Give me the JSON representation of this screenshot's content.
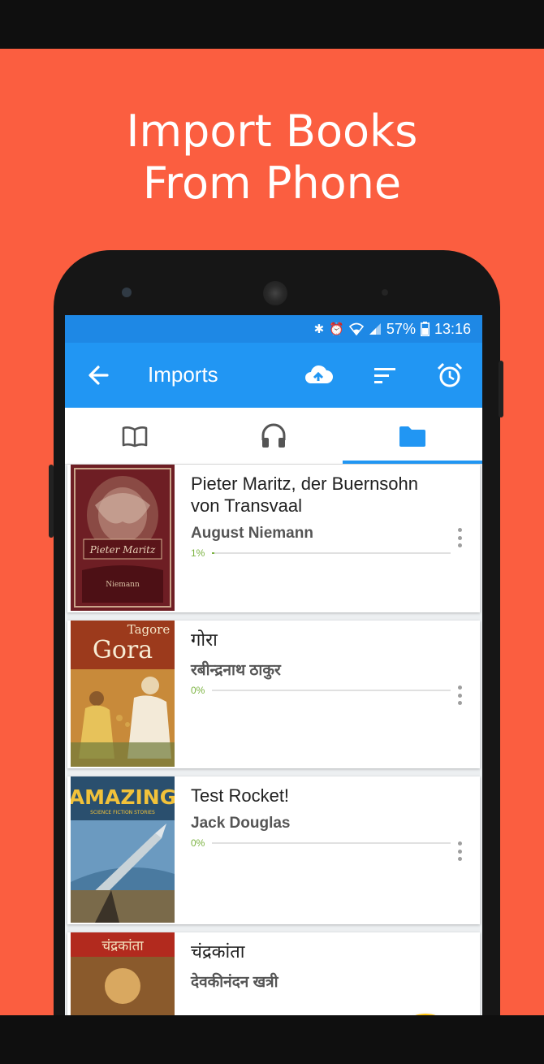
{
  "promo": {
    "line1": "Import Books",
    "line2": "From Phone"
  },
  "status_bar": {
    "battery": "57%",
    "time": "13:16",
    "icons": [
      "bluetooth-icon",
      "alarm-icon",
      "wifi-icon",
      "signal-icon",
      "battery-icon"
    ]
  },
  "toolbar": {
    "title": "Imports",
    "back_icon": "arrow-left-icon",
    "actions": [
      "cloud-upload-icon",
      "sort-icon",
      "alarm-clock-icon"
    ]
  },
  "tabs": [
    {
      "icon": "book-icon",
      "selected": false
    },
    {
      "icon": "headphones-icon",
      "selected": false
    },
    {
      "icon": "folder-icon",
      "selected": true
    }
  ],
  "books": [
    {
      "title": "Pieter Maritz, der Buernsohn von Transvaal",
      "author": "August Niemann",
      "progress": "1%",
      "progress_value": 1,
      "cover_text": [
        "Pieter Maritz",
        "Niemann"
      ]
    },
    {
      "title": "गोरा",
      "author": "रबीन्द्रनाथ ठाकुर",
      "progress": "0%",
      "progress_value": 0,
      "cover_text": [
        "Tagore",
        "Gora"
      ]
    },
    {
      "title": "Test Rocket!",
      "author": "Jack Douglas",
      "progress": "0%",
      "progress_value": 0,
      "cover_text": [
        "AMAZING",
        "SCIENCE FICTION STORIES"
      ]
    },
    {
      "title": "चंद्रकांता",
      "author": "देवकीनंदन खत्री",
      "progress": "",
      "progress_value": 0,
      "cover_text": [
        "चंद्रकांता"
      ]
    }
  ],
  "fab": {
    "label": "+"
  },
  "colors": {
    "promo_bg": "#fb5e40",
    "toolbar": "#2196f3",
    "status_bar": "#1e88e5",
    "accent": "#2196f3",
    "fab": "#ffc107",
    "progress": "#7cb342"
  }
}
